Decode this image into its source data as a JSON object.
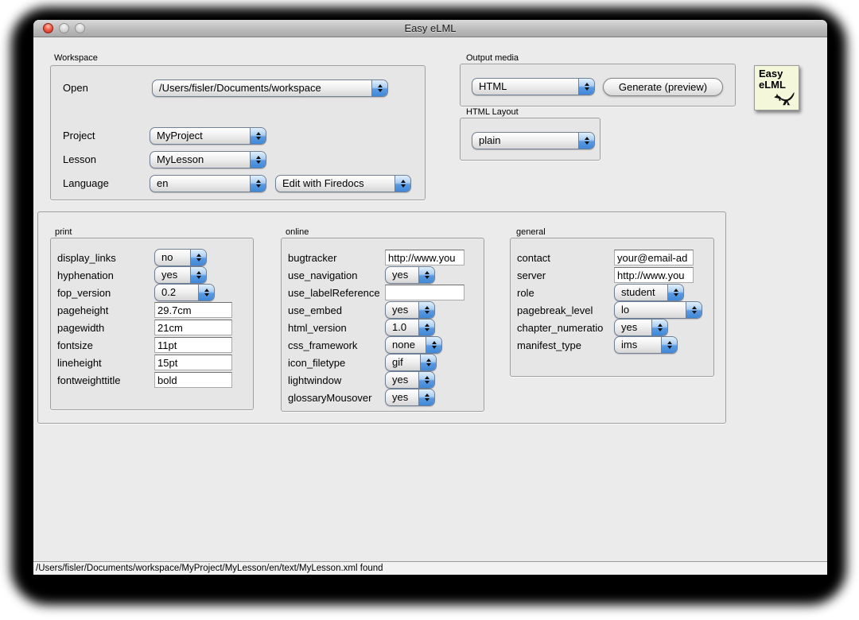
{
  "window": {
    "title": "Easy eLML"
  },
  "workspace": {
    "label": "Workspace",
    "open_label": "Open",
    "open_value": "/Users/fisler/Documents/workspace",
    "project_label": "Project",
    "project_value": "MyProject",
    "lesson_label": "Lesson",
    "lesson_value": "MyLesson",
    "language_label": "Language",
    "language_value": "en",
    "editor_value": "Edit with Firedocs"
  },
  "output_media": {
    "label": "Output media",
    "format_value": "HTML",
    "generate_label": "Generate (preview)"
  },
  "html_layout": {
    "label": "HTML Layout",
    "value": "plain"
  },
  "logo": {
    "line1": "Easy",
    "line2": "eLML",
    "icon": "kangaroo-icon",
    "bg_color": "#f4f7da"
  },
  "settings": {
    "print": {
      "label": "print",
      "rows": [
        {
          "label": "display_links",
          "type": "popup",
          "value": "no"
        },
        {
          "label": "hyphenation",
          "type": "popup",
          "value": "yes"
        },
        {
          "label": "fop_version",
          "type": "popup",
          "value": "0.2"
        },
        {
          "label": "pageheight",
          "type": "input",
          "value": "29.7cm"
        },
        {
          "label": "pagewidth",
          "type": "input",
          "value": "21cm"
        },
        {
          "label": "fontsize",
          "type": "input",
          "value": "11pt"
        },
        {
          "label": "lineheight",
          "type": "input",
          "value": "15pt"
        },
        {
          "label": "fontweighttitle",
          "type": "input",
          "value": "bold"
        }
      ]
    },
    "online": {
      "label": "online",
      "rows": [
        {
          "label": "bugtracker",
          "type": "input",
          "value": "http://www.you"
        },
        {
          "label": "use_navigation",
          "type": "popup",
          "value": "yes"
        },
        {
          "label": "use_labelReference",
          "type": "input",
          "value": ""
        },
        {
          "label": "use_embed",
          "type": "popup",
          "value": "yes"
        },
        {
          "label": "html_version",
          "type": "popup",
          "value": "1.0"
        },
        {
          "label": "css_framework",
          "type": "popup",
          "value": "none"
        },
        {
          "label": "icon_filetype",
          "type": "popup",
          "value": "gif"
        },
        {
          "label": "lightwindow",
          "type": "popup",
          "value": "yes"
        },
        {
          "label": "glossaryMousover",
          "type": "popup",
          "value": "yes"
        }
      ]
    },
    "general": {
      "label": "general",
      "rows": [
        {
          "label": "contact",
          "type": "input",
          "value": "your@email-ad"
        },
        {
          "label": "server",
          "type": "input",
          "value": "http://www.you"
        },
        {
          "label": "role",
          "type": "popup",
          "value": "student"
        },
        {
          "label": "pagebreak_level",
          "type": "popup",
          "value": "lo"
        },
        {
          "label": "chapter_numeratio",
          "type": "popup",
          "value": "yes"
        },
        {
          "label": "manifest_type",
          "type": "popup",
          "value": "ims"
        }
      ]
    }
  },
  "status_bar": {
    "text": "/Users/fisler/Documents/workspace/MyProject/MyLesson/en/text/MyLesson.xml found"
  },
  "colors": {
    "window_bg": "#ebebeb",
    "popup_blue": "#3f88d7",
    "logo_bg": "#f4f7da",
    "shadow": "#000000"
  }
}
